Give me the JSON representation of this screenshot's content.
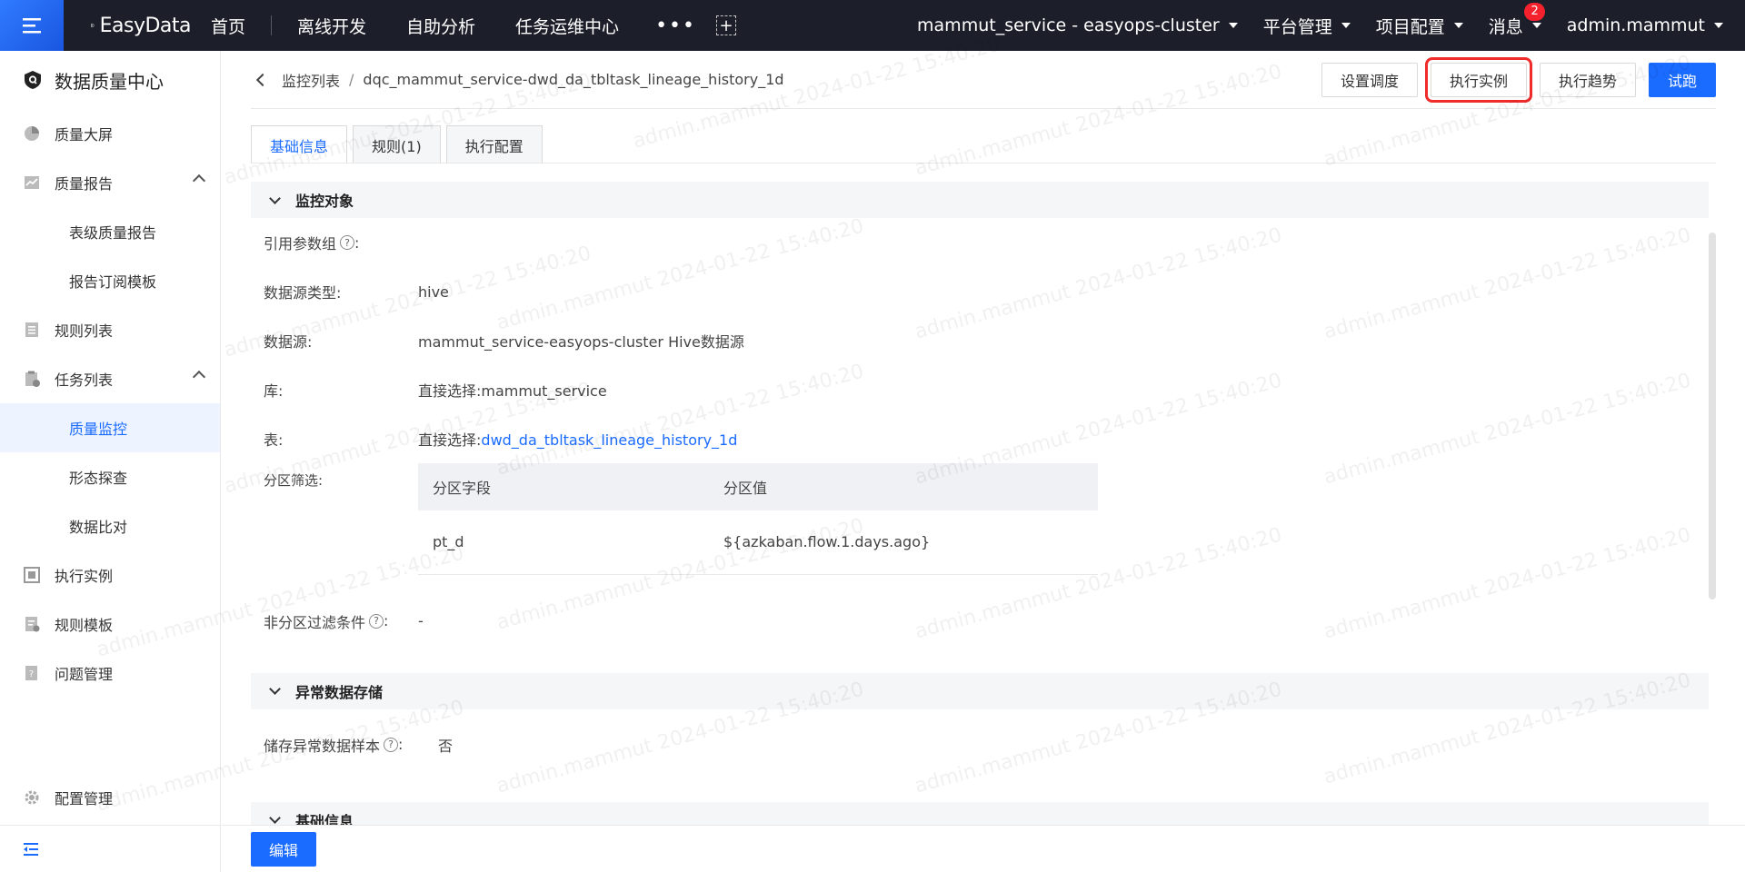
{
  "topbar": {
    "logo": "EasyData",
    "nav": [
      "首页",
      "离线开发",
      "自助分析",
      "任务运维中心"
    ],
    "more": "•••",
    "cluster": "mammut_service - easyops-cluster",
    "platform": "平台管理",
    "project": "项目配置",
    "messages": "消息",
    "message_count": "2",
    "user": "admin.mammut"
  },
  "sidebar": {
    "title": "数据质量中心",
    "items": [
      {
        "label": "质量大屏",
        "icon": "pie-chart-icon"
      },
      {
        "label": "质量报告",
        "icon": "line-chart-icon"
      },
      {
        "label": "表级质量报告"
      },
      {
        "label": "报告订阅模板"
      },
      {
        "label": "规则列表",
        "icon": "list-icon"
      },
      {
        "label": "任务列表",
        "icon": "clipboard-icon"
      },
      {
        "label": "质量监控"
      },
      {
        "label": "形态探查"
      },
      {
        "label": "数据比对"
      },
      {
        "label": "执行实例",
        "icon": "instance-icon"
      },
      {
        "label": "规则模板",
        "icon": "template-icon"
      },
      {
        "label": "问题管理",
        "icon": "issue-icon"
      },
      {
        "label": "配置管理",
        "icon": "gear-icon"
      }
    ]
  },
  "breadcrumb": {
    "parent": "监控列表",
    "current": "dqc_mammut_service-dwd_da_tbltask_lineage_history_1d"
  },
  "actions": {
    "schedule": "设置调度",
    "instances": "执行实例",
    "trend": "执行趋势",
    "trial": "试跑"
  },
  "tabs": [
    "基础信息",
    "规则(1)",
    "执行配置"
  ],
  "section_monitor": {
    "title": "监控对象",
    "param_group_label": "引用参数组",
    "ds_type_label": "数据源类型:",
    "ds_type": "hive",
    "ds_label": "数据源:",
    "ds": "mammut_service-easyops-cluster Hive数据源",
    "db_label": "库:",
    "db_prefix": "直接选择:",
    "db": "mammut_service",
    "table_label": "表:",
    "table_prefix": "直接选择:",
    "table": "dwd_da_tbltask_lineage_history_1d",
    "partition_label": "分区筛选:",
    "partition_headers": [
      "分区字段",
      "分区值"
    ],
    "partition_rows": [
      [
        "pt_d",
        "${azkaban.flow.1.days.ago}"
      ]
    ],
    "nonpart_label": "非分区过滤条件",
    "nonpart": "-"
  },
  "section_abnormal": {
    "title": "异常数据存储",
    "store_label": "储存异常数据样本",
    "store": "否"
  },
  "section_basic": {
    "title": "基础信息"
  },
  "footer": {
    "edit": "编辑"
  },
  "watermark": "admin.mammut 2024-01-22 15:40:20"
}
